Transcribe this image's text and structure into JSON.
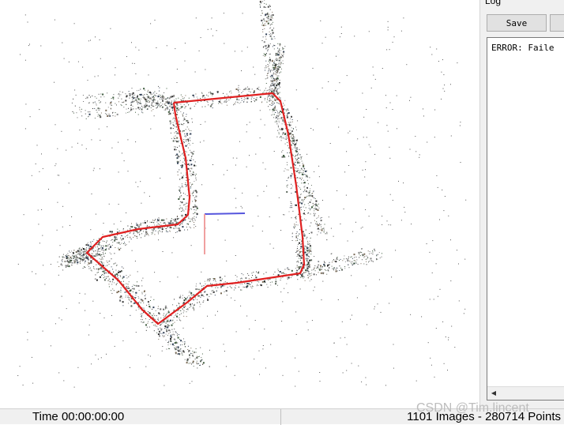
{
  "log": {
    "title": "Log",
    "save_label": "Save",
    "text": "ERROR: Faile"
  },
  "status": {
    "time": "Time 00:00:00:00",
    "counts": "1101 Images - 280714 Points"
  },
  "watermark": "CSDN @Tim.lincent",
  "colors": {
    "trajectory": "#e02020",
    "axis": "#5555dd",
    "points": "#3a3a3a"
  },
  "icons": {
    "scroll_left": "triangle-left"
  }
}
